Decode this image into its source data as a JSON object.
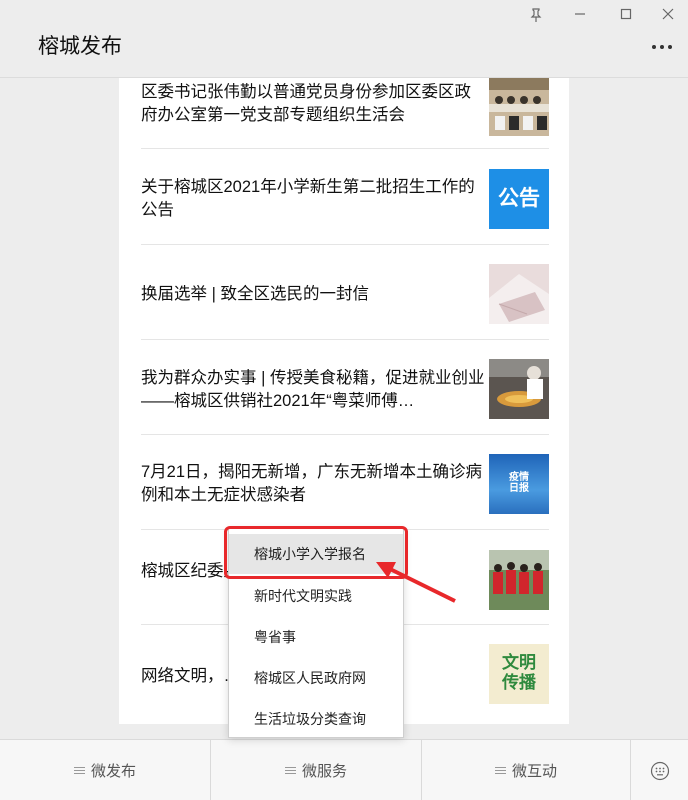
{
  "window": {
    "title": "榕城发布",
    "controls": [
      "pin-icon",
      "minimize-icon",
      "maximize-icon",
      "close-icon"
    ]
  },
  "articles": [
    {
      "title": "区委书记张伟勤以普通党员身份参加区委区政府办公室第一党支部专题组织生活会",
      "thumb": "meeting-photo"
    },
    {
      "title": "关于榕城区2021年小学新生第二批招生工作的公告",
      "thumb": "notice-badge",
      "thumb_text": "公告"
    },
    {
      "title": "换届选举 | 致全区选民的一封信",
      "thumb": "envelope-photo"
    },
    {
      "title": "我为群众办实事 | 传授美食秘籍，促进就业创业——榕城区供销社2021年“粤菜师傅…",
      "thumb": "cooking-photo"
    },
    {
      "title": "7月21日，揭阳无新增，广东无新增本土确诊病例和本土无症状感染者",
      "thumb": "epidemic-report",
      "thumb_text": [
        "疫情",
        "日报"
      ]
    },
    {
      "title": "榕城区纪委监委……播廉洁文化",
      "thumb": "volunteers-photo"
    },
    {
      "title": "网络文明，……",
      "thumb": "civilization-badge",
      "thumb_text": [
        "文明",
        "传播"
      ]
    }
  ],
  "menu": {
    "items": [
      "榕城小学入学报名",
      "新时代文明实践",
      "粤省事",
      "榕城区人民政府网",
      "生活垃圾分类查询"
    ],
    "active_index": 0
  },
  "tabs": [
    {
      "label": "微发布"
    },
    {
      "label": "微服务"
    },
    {
      "label": "微互动"
    }
  ],
  "colors": {
    "highlight": "#e8282b",
    "notice_blue": "#1e8fe6",
    "civilization_green": "#2f8a3e"
  }
}
